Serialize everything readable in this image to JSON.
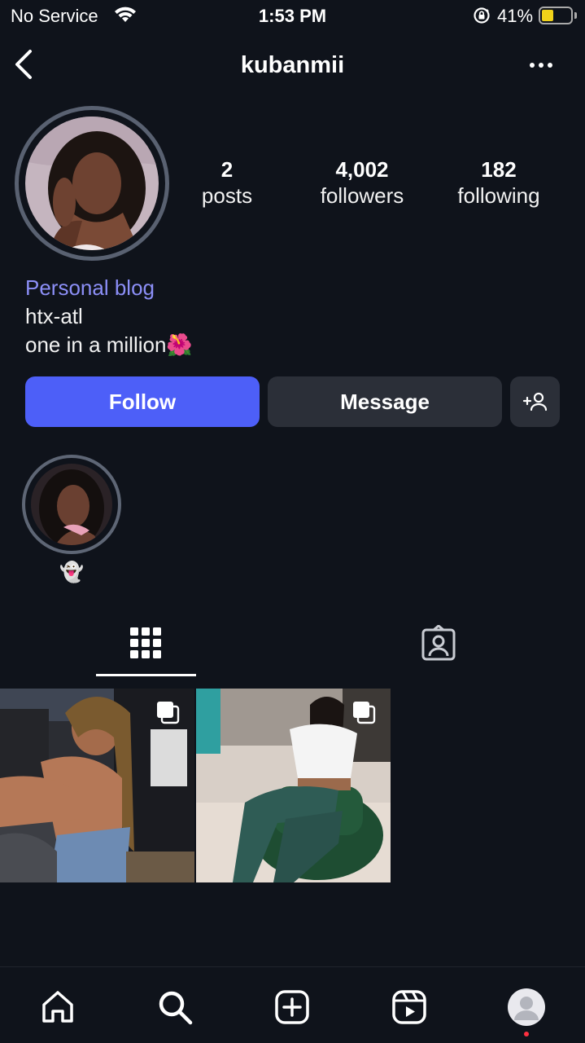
{
  "status_bar": {
    "carrier": "No Service",
    "time": "1:53 PM",
    "battery_percent": "41%",
    "battery_level": 0.41,
    "icons": [
      "wifi-icon",
      "rotation-lock-icon",
      "battery-icon"
    ]
  },
  "header": {
    "username": "kubanmii",
    "back_icon": "chevron-left-icon",
    "more_icon": "more-horizontal-icon"
  },
  "profile": {
    "stats": {
      "posts_count": "2",
      "posts_label": "posts",
      "followers_count": "4,002",
      "followers_label": "followers",
      "following_count": "182",
      "following_label": "following"
    },
    "bio": {
      "category": "Personal blog",
      "line1": "htx-atl",
      "line2": "one in a million🌺"
    }
  },
  "actions": {
    "follow_label": "Follow",
    "message_label": "Message",
    "suggest_icon": "add-person-icon"
  },
  "highlights": [
    {
      "label": "👻"
    }
  ],
  "tabs": [
    {
      "name": "grid",
      "icon": "grid-icon",
      "active": true
    },
    {
      "name": "tagged",
      "icon": "tagged-person-icon",
      "active": false
    }
  ],
  "posts": [
    {
      "type": "multiple",
      "icon": "multiple-posts-icon"
    },
    {
      "type": "multiple",
      "icon": "multiple-posts-icon"
    }
  ],
  "bottom_nav": [
    {
      "name": "home",
      "icon": "home-icon"
    },
    {
      "name": "search",
      "icon": "search-icon"
    },
    {
      "name": "create",
      "icon": "plus-square-icon"
    },
    {
      "name": "reels",
      "icon": "reels-icon"
    },
    {
      "name": "profile",
      "icon": "profile-avatar-icon",
      "notification_dot": true
    }
  ],
  "colors": {
    "background": "#0f131b",
    "accent": "#4d5ff8",
    "secondary_button": "#2b2f38",
    "category_text": "#8c8ff7",
    "battery_fill": "#f1d31a",
    "notification": "#ff3040"
  }
}
